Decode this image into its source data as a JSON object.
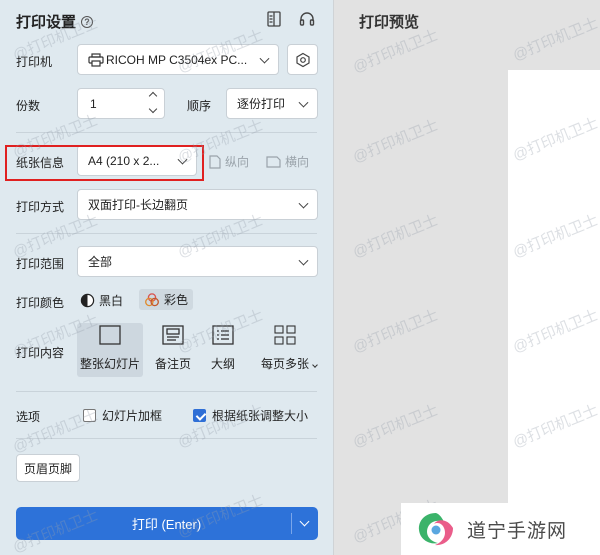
{
  "settings": {
    "title": "打印设置",
    "help_icon": "?",
    "printer": {
      "label": "打印机",
      "value": "RICOH MP C3504ex PC..."
    },
    "copies": {
      "label": "份数",
      "value": "1"
    },
    "order": {
      "label": "顺序",
      "value": "逐份打印"
    },
    "paper": {
      "label": "纸张信息",
      "value": "A4 (210 x 2...",
      "portrait": "纵向",
      "landscape": "横向"
    },
    "duplex": {
      "label": "打印方式",
      "value": "双面打印-长边翻页"
    },
    "range": {
      "label": "打印范围",
      "value": "全部"
    },
    "color": {
      "label": "打印颜色",
      "mono": "黑白",
      "color": "彩色"
    },
    "content": {
      "label": "打印内容",
      "items": [
        "整张幻灯片",
        "备注页",
        "大纲",
        "每页多张"
      ]
    },
    "options": {
      "label": "选项",
      "frame": "幻灯片加框",
      "fit": "根据纸张调整大小"
    },
    "header_footer": "页眉页脚",
    "print_button": "打印 (Enter)"
  },
  "preview": {
    "title": "打印预览"
  },
  "watermark": "@打印机卫士",
  "logo": {
    "text": "道宁手游网"
  },
  "colors": {
    "accent": "#2d72d9",
    "highlight": "#e02020"
  }
}
